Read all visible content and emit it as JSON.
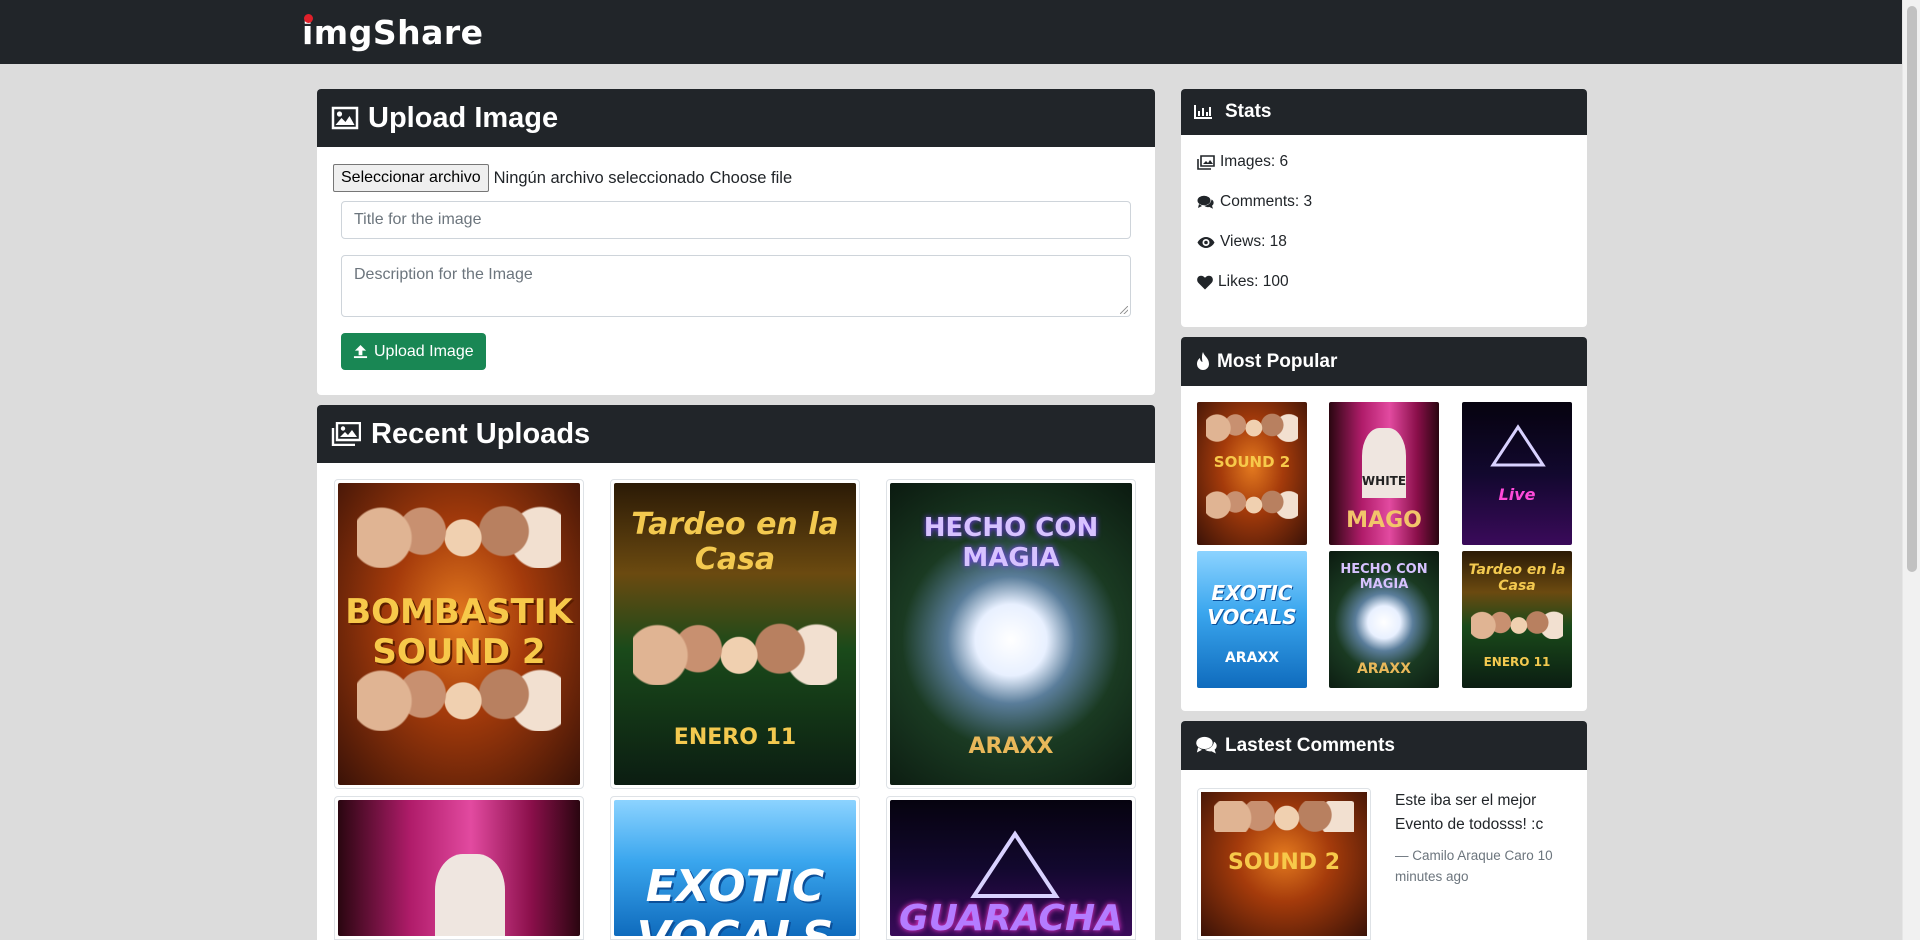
{
  "colors": {
    "navbar": "#212529",
    "page_bg": "#dcdcdc",
    "primary_action": "#198754",
    "logo_dot": "#e0202a"
  },
  "navbar": {
    "brand": "imgShare"
  },
  "upload": {
    "header_icon": "image-icon",
    "title": "Upload Image",
    "file_button": "Seleccionar archivo",
    "file_status": "Ningún archivo seleccionado",
    "file_label": "Choose file",
    "title_placeholder": "Title for the image",
    "description_placeholder": "Description for the Image",
    "submit_label": "Upload Image",
    "submit_icon": "upload-icon"
  },
  "recent": {
    "header_icon": "images-icon",
    "title": "Recent Uploads",
    "posters": [
      {
        "text": "BOMBASTIK SOUND 2"
      },
      {
        "text": "Tardeo en la Casa"
      },
      {
        "text": "HECHO CON MAGIA"
      },
      {
        "text": "WHITE MAGO"
      },
      {
        "text": "EXOTIC VOCALS"
      },
      {
        "text": "GUARACHA"
      }
    ]
  },
  "stats": {
    "title": "Stats",
    "header_icon": "chart-bar-icon",
    "items": [
      {
        "icon": "images-icon",
        "label": "Images: 6"
      },
      {
        "icon": "comments-icon",
        "label": "Comments: 3"
      },
      {
        "icon": "eye-icon",
        "label": "Views: 18"
      },
      {
        "icon": "heart-icon",
        "label": "Likes: 100"
      }
    ]
  },
  "popular": {
    "title": "Most Popular",
    "header_icon": "fire-icon"
  },
  "comments": {
    "title": "Lastest Comments",
    "header_icon": "comments-icon",
    "items": [
      {
        "text": "Este iba ser el mejor Evento de todosss! :c",
        "author": "— Camilo Araque Caro",
        "time": "10 minutes ago"
      }
    ]
  }
}
